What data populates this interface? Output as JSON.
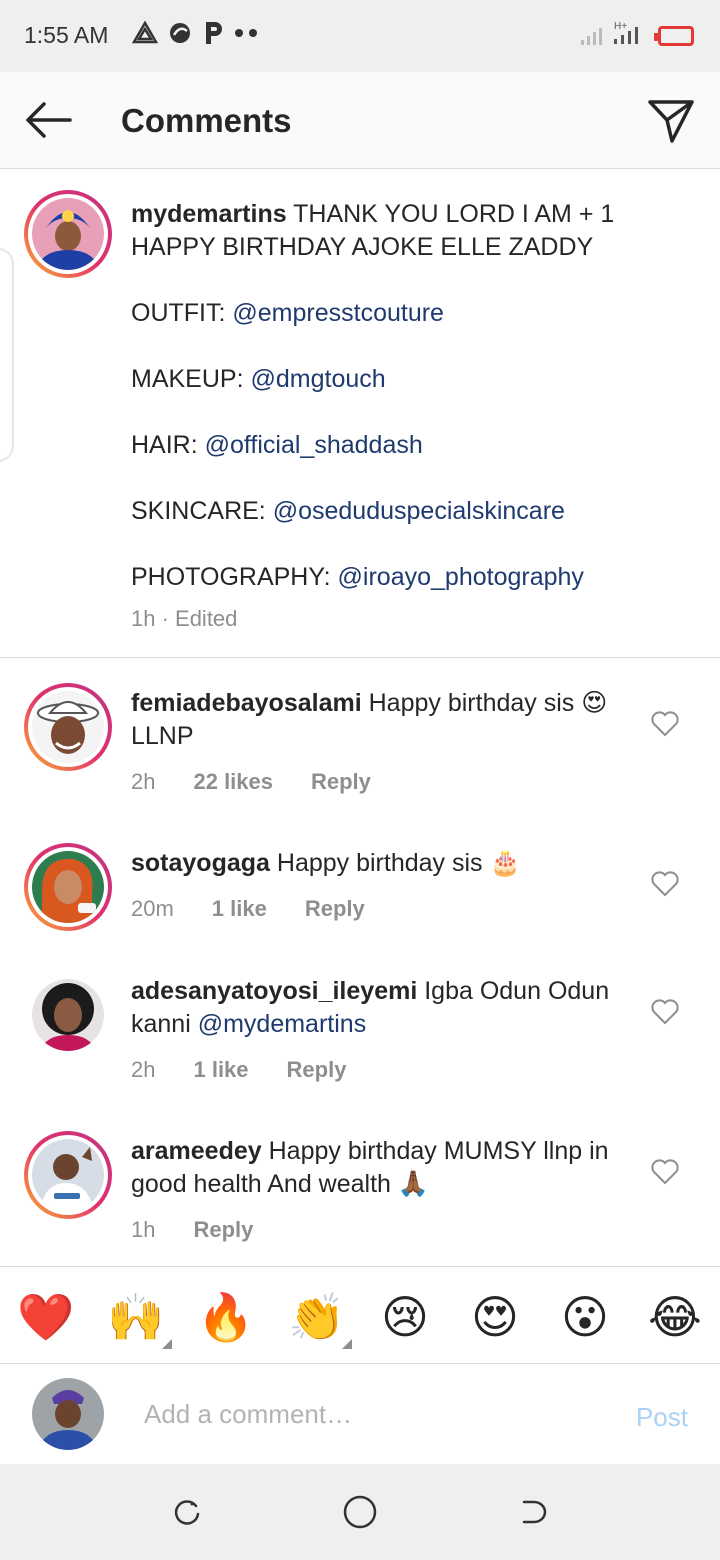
{
  "status_bar": {
    "time": "1:55 AM",
    "network": "H+"
  },
  "header": {
    "title": "Comments"
  },
  "caption": {
    "username": "mydemartins",
    "line1": "THANK YOU LORD I AM + 1 HAPPY BIRTHDAY AJOKE ELLE ZADDY",
    "outfit_label": "OUTFIT:",
    "outfit_mention": "@empresstcouture",
    "makeup_label": "MAKEUP:",
    "makeup_mention": "@dmgtouch",
    "hair_label": "HAIR:",
    "hair_mention": "@official_shaddash",
    "skincare_label": "SKINCARE:",
    "skincare_mention": "@oseduduspecialskincare",
    "photography_label": "PHOTOGRAPHY:",
    "photography_mention": "@iroayo_photography",
    "meta": "1h · Edited"
  },
  "comments": [
    {
      "username": "femiadebayosalami",
      "text": "Happy birthday sis 😍 LLNP",
      "time": "2h",
      "likes": "22 likes",
      "reply": "Reply"
    },
    {
      "username": "sotayogaga",
      "text": "Happy birthday sis 🎂",
      "time": "20m",
      "likes": "1 like",
      "reply": "Reply"
    },
    {
      "username": "adesanyatoyosi_ileyemi",
      "text": "Igba Odun Odun kanni",
      "mention": "@mydemartins",
      "time": "2h",
      "likes": "1 like",
      "reply": "Reply"
    },
    {
      "username": "arameedey",
      "text": "Happy birthday MUMSY llnp in good health And wealth 🙏🏾",
      "time": "1h",
      "reply": "Reply"
    }
  ],
  "emoji_bar": [
    "❤️",
    "🙌",
    "🔥",
    "👏",
    "😢",
    "😍",
    "😮",
    "😂"
  ],
  "add_comment": {
    "placeholder": "Add a comment…",
    "post_label": "Post"
  },
  "colors": {
    "mention": "#1e3a6e",
    "post_disabled": "#a9d2f5",
    "meta_gray": "#8e8e8e"
  }
}
